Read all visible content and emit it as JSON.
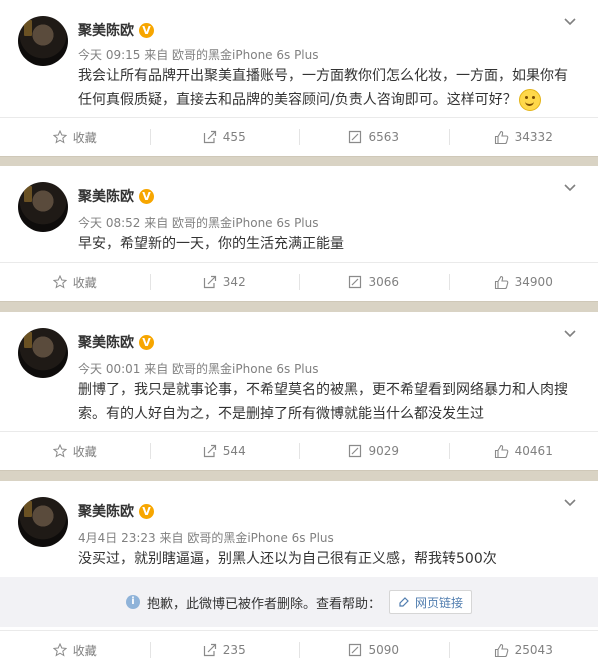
{
  "posts": [
    {
      "author": "聚美陈欧",
      "badge": "V",
      "time": "今天 09:15",
      "source": "来自 欧哥的黑金iPhone 6s Plus",
      "text_line1": "我会让所有品牌开出聚美直播账号，一方面教你们怎么化妆，一方面，如果你有",
      "text_line2": "任何真假质疑，直接去和品牌的美容顾问/负责人咨询即可。这样可好？",
      "emoji": "smile-emoji",
      "favorite_label": "收藏",
      "repost_count": "455",
      "comment_count": "6563",
      "like_count": "34332"
    },
    {
      "author": "聚美陈欧",
      "badge": "V",
      "time": "今天 08:52",
      "source": "来自 欧哥的黑金iPhone 6s Plus",
      "text_line1": "早安，希望新的一天，你的生活充满正能量",
      "favorite_label": "收藏",
      "repost_count": "342",
      "comment_count": "3066",
      "like_count": "34900"
    },
    {
      "author": "聚美陈欧",
      "badge": "V",
      "time": "今天 00:01",
      "source": "来自 欧哥的黑金iPhone 6s Plus",
      "text_line1": "删博了，我只是就事论事，不希望莫名的被黑，更不希望看到网络暴力和人肉搜",
      "text_line2": "索。有的人好自为之，不是删掉了所有微博就能当什么都没发生过",
      "favorite_label": "收藏",
      "repost_count": "544",
      "comment_count": "9029",
      "like_count": "40461"
    },
    {
      "author": "聚美陈欧",
      "badge": "V",
      "time": "4月4日 23:23",
      "source": "来自 欧哥的黑金iPhone 6s Plus",
      "text_line1": "没买过，就别瞎逼逼，别黑人还以为自己很有正义感，帮我转500次",
      "deleted_notice": "抱歉，此微博已被作者删除。查看帮助：",
      "weblink_label": "网页链接",
      "favorite_label": "收藏",
      "repost_count": "235",
      "comment_count": "5090",
      "like_count": "25043"
    }
  ],
  "colors": {
    "background": "#d9d3c4",
    "badge": "#f7a600",
    "link": "#507daf",
    "meta_text": "#808080"
  }
}
